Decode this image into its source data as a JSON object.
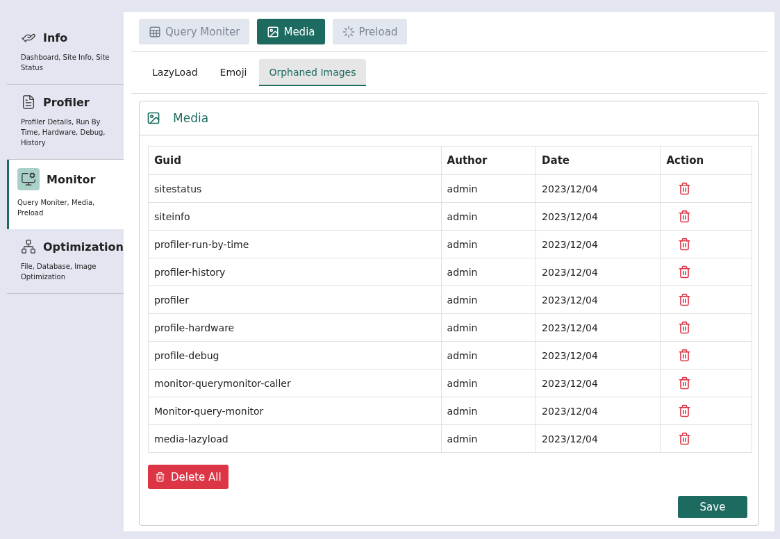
{
  "sidebar": {
    "items": [
      {
        "title": "Info",
        "description": "Dashboard, Site Info, Site Status",
        "selected": false
      },
      {
        "title": "Profiler",
        "description": "Profiler Details, Run By Time, Hardware, Debug, History",
        "selected": false
      },
      {
        "title": "Monitor",
        "description": "Query Moniter, Media, Preload",
        "selected": true
      },
      {
        "title": "Optimization",
        "description": "File, Database, Image Optimization",
        "selected": false
      }
    ]
  },
  "tabs": [
    {
      "label": "Query Moniter",
      "selected": false
    },
    {
      "label": "Media",
      "selected": true
    },
    {
      "label": "Preload",
      "selected": false
    }
  ],
  "subtabs": [
    {
      "label": "LazyLoad",
      "selected": false
    },
    {
      "label": "Emoji",
      "selected": false
    },
    {
      "label": "Orphaned Images",
      "selected": true
    }
  ],
  "card": {
    "title": "Media",
    "table": {
      "columns": [
        "Guid",
        "Author",
        "Date",
        "Action"
      ],
      "rows": [
        {
          "guid": "sitestatus",
          "author": "admin",
          "date": "2023/12/04"
        },
        {
          "guid": "siteinfo",
          "author": "admin",
          "date": "2023/12/04"
        },
        {
          "guid": "profiler-run-by-time",
          "author": "admin",
          "date": "2023/12/04"
        },
        {
          "guid": "profiler-history",
          "author": "admin",
          "date": "2023/12/04"
        },
        {
          "guid": "profiler",
          "author": "admin",
          "date": "2023/12/04"
        },
        {
          "guid": "profile-hardware",
          "author": "admin",
          "date": "2023/12/04"
        },
        {
          "guid": "profile-debug",
          "author": "admin",
          "date": "2023/12/04"
        },
        {
          "guid": "monitor-querymonitor-caller",
          "author": "admin",
          "date": "2023/12/04"
        },
        {
          "guid": "Monitor-query-monitor",
          "author": "admin",
          "date": "2023/12/04"
        },
        {
          "guid": "media-lazyload",
          "author": "admin",
          "date": "2023/12/04"
        }
      ]
    },
    "delete_all": "Delete All",
    "save": "Save"
  }
}
